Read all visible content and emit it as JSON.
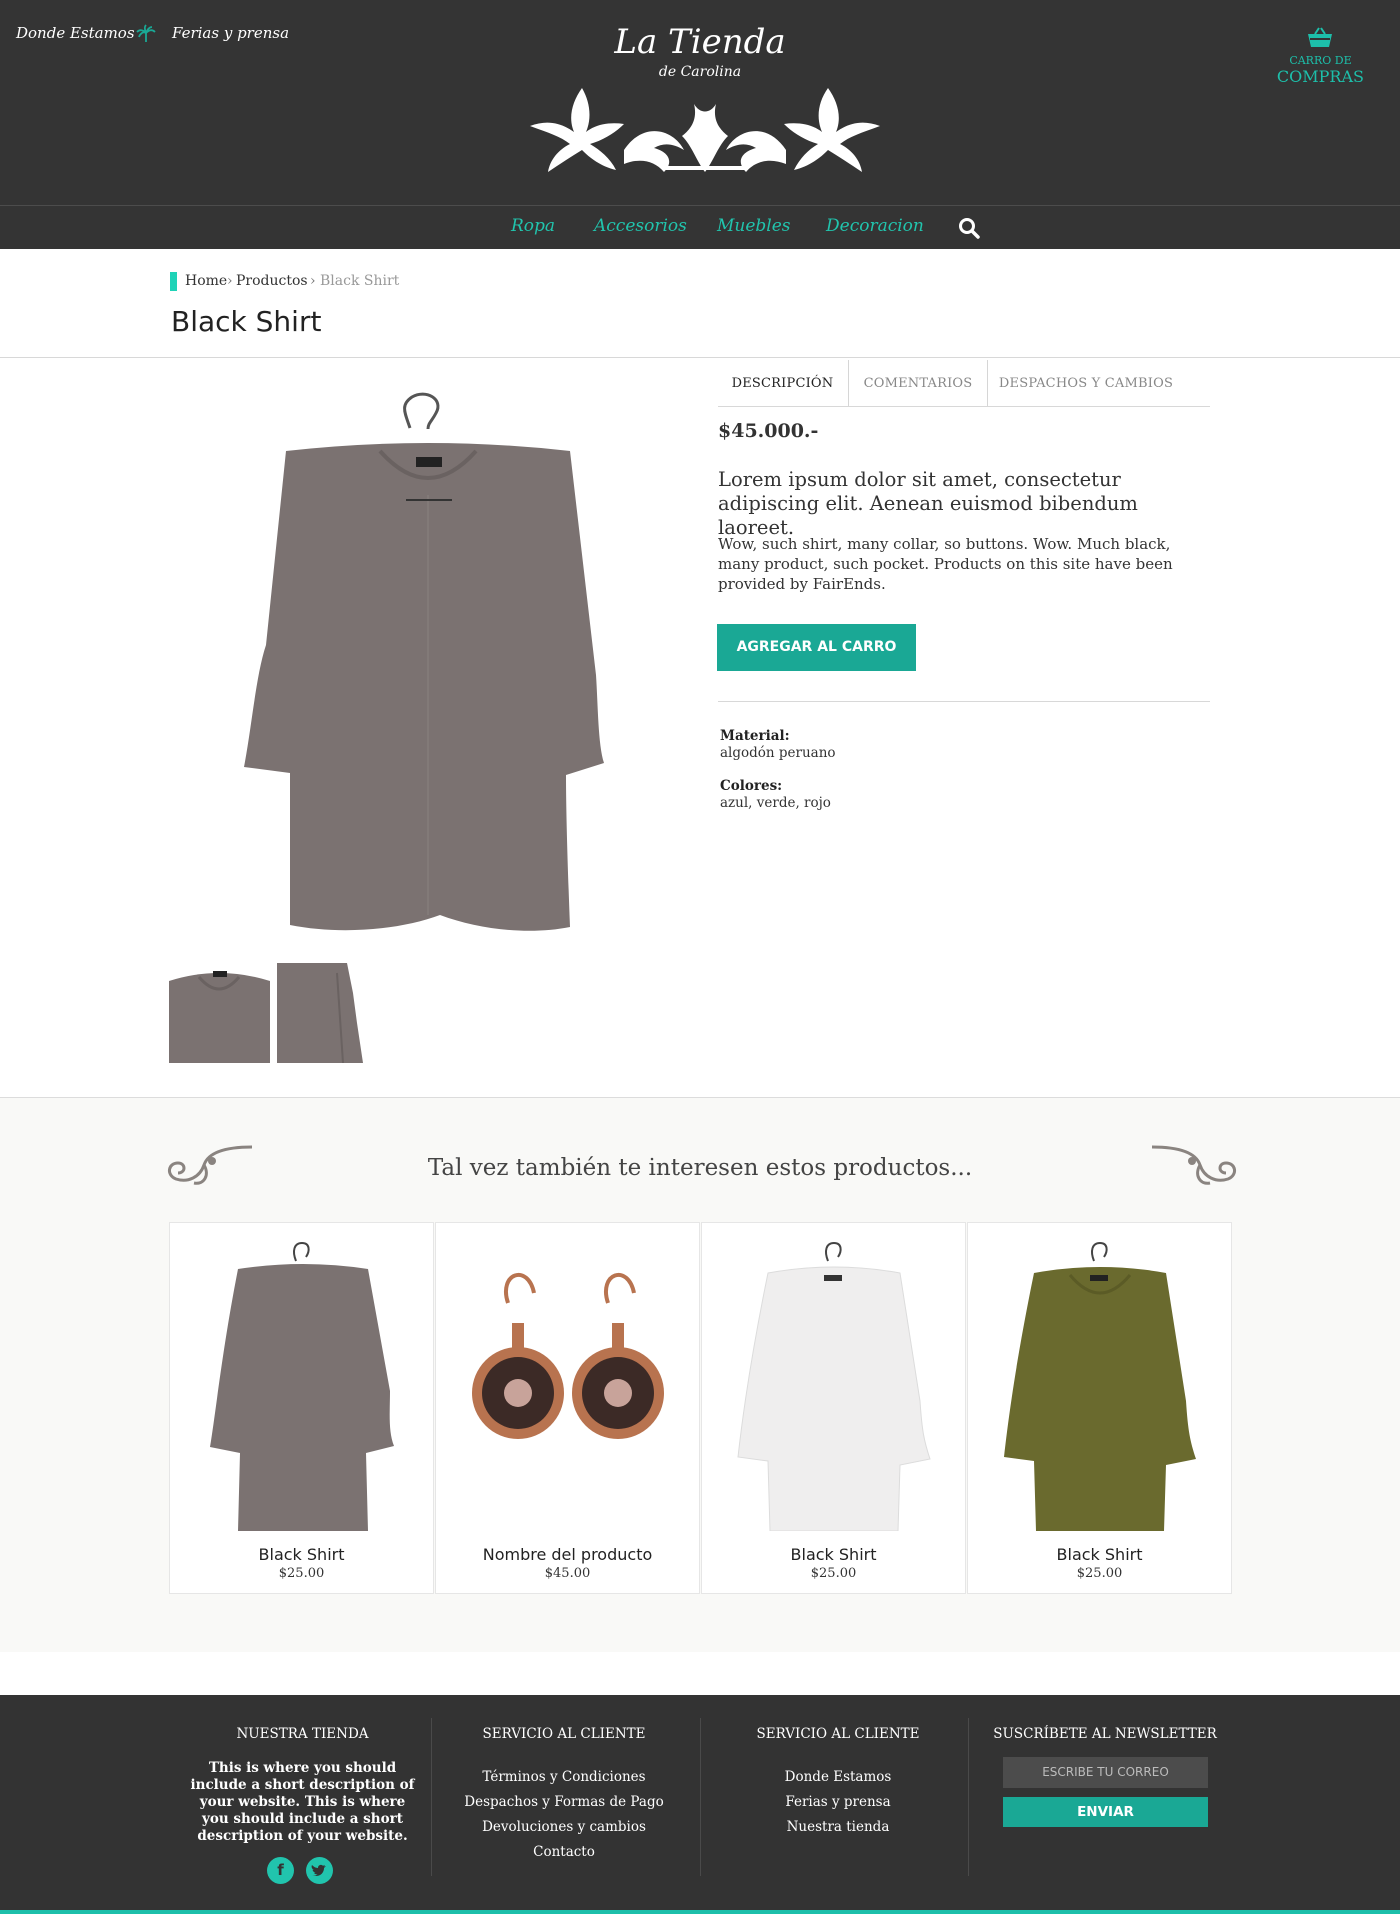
{
  "header": {
    "top_links": [
      "Donde Estamos",
      "Ferias y prensa"
    ],
    "logo": {
      "title": "La Tienda",
      "subtitle": "de Carolina"
    },
    "cart": {
      "line1": "CARRO DE",
      "line2": "COMPRAS"
    },
    "nav": [
      "Ropa",
      "Accesorios",
      "Muebles",
      "Decoracion"
    ]
  },
  "breadcrumb": {
    "home": "Home",
    "section": "Productos",
    "current": "Black Shirt"
  },
  "product": {
    "title": "Black Shirt",
    "tabs": [
      "DESCRIPCIÓN",
      "COMENTARIOS",
      "DESPACHOS Y CAMBIOS"
    ],
    "price": "$45.000.-",
    "lead": "Lorem ipsum dolor sit amet, consectetur adipiscing elit. Aenean euismod bibendum laoreet.",
    "description": "Wow, such shirt, many collar, so buttons. Wow. Much black, many product, such pocket. Products on this site have been provided by FairEnds.",
    "add_to_cart": "AGREGAR AL CARRO",
    "specs": [
      {
        "label": "Material:",
        "value": "algodón peruano"
      },
      {
        "label": "Colores:",
        "value": "azul, verde, rojo"
      }
    ]
  },
  "related": {
    "title": "Tal vez también te interesen estos productos...",
    "items": [
      {
        "name": "Black Shirt",
        "price": "$25.00",
        "color": "#7b7271"
      },
      {
        "name": "Nombre del producto",
        "price": "$45.00",
        "color": "#b8734f"
      },
      {
        "name": "Black Shirt",
        "price": "$25.00",
        "color": "#efeeee"
      },
      {
        "name": "Black Shirt",
        "price": "$25.00",
        "color": "#6a6a2e"
      }
    ]
  },
  "footer": {
    "col1": {
      "title": "NUESTRA TIENDA",
      "text": "This is where you should include a short description of your website. This is where you should include a short description of your website."
    },
    "col2": {
      "title": "SERVICIO AL CLIENTE",
      "links": [
        "Términos y Condiciones",
        "Despachos y Formas de Pago",
        "Devoluciones y cambios",
        "Contacto"
      ]
    },
    "col3": {
      "title": "SERVICIO AL CLIENTE",
      "links": [
        "Donde Estamos",
        "Ferias y prensa",
        "Nuestra tienda"
      ]
    },
    "col4": {
      "title": "SUSCRÍBETE AL NEWSLETTER",
      "email_placeholder": "ESCRIBE TU CORREO",
      "send": "ENVIAR"
    },
    "social": [
      "facebook-icon",
      "twitter-icon"
    ]
  },
  "colors": {
    "accent": "#1aa895",
    "accent_light": "#21c4ad",
    "header_bg": "#343434"
  }
}
